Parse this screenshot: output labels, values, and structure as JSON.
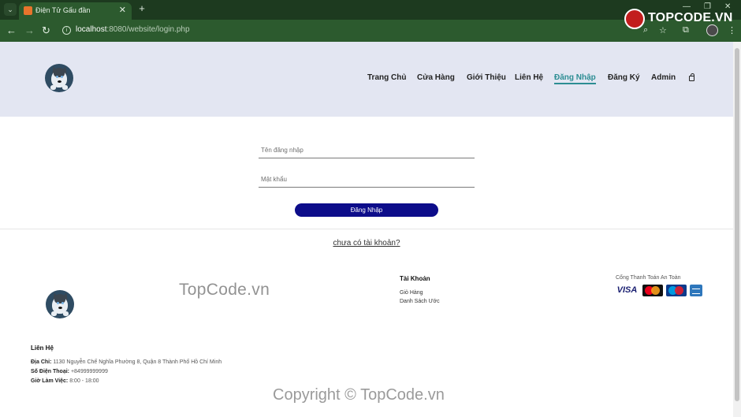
{
  "browser": {
    "tab_title": "Điện Tử Gấu đần",
    "tab_close": "✕",
    "new_tab": "+",
    "url_host": "localhost",
    "url_path": ":8080/website/login.php",
    "window_controls": [
      "—",
      "❐",
      "✕"
    ]
  },
  "watermark": {
    "logo_text": "TOPCODE.VN",
    "mid_text": "TopCode.vn",
    "copyright": "Copyright © TopCode.vn"
  },
  "site": {
    "nav": [
      {
        "label": "Trang Chủ",
        "active": false
      },
      {
        "label": "Cửa Hàng",
        "active": false
      },
      {
        "label": "Giới Thiệu",
        "active": false
      },
      {
        "label": "Liên Hệ",
        "active": false
      },
      {
        "label": "Đăng Nhập",
        "active": true
      },
      {
        "label": "Đăng Ký",
        "active": false
      },
      {
        "label": "Admin",
        "active": false
      }
    ],
    "accent_color": "#2c8d93"
  },
  "login": {
    "username_placeholder": "Tên đăng nhập",
    "password_placeholder": "Mật khẩu",
    "submit_label": "Đăng Nhập",
    "submit_color": "#0d0d8a",
    "register_link": "chưa có tài khoản?"
  },
  "footer": {
    "account_title": "Tài Khoản",
    "account_links": [
      "Giỏ Hàng",
      "Danh Sách Ước"
    ],
    "payment_title": "Cổng Thanh Toán An Toàn",
    "payment_cards": [
      "VISA",
      "MasterCard",
      "Maestro",
      "American Express"
    ],
    "contact_title": "Liên Hệ",
    "address_label": "Địa Chỉ:",
    "address_value": " 1130 Nguyễn Chế Nghĩa Phường 8, Quận 8 Thành Phố Hồ Chí Minh",
    "phone_label": "Số Điện Thoại:",
    "phone_value": " +84999999999",
    "hours_label": "Giờ Làm Việc:",
    "hours_value": " 8:00 - 18:00"
  }
}
